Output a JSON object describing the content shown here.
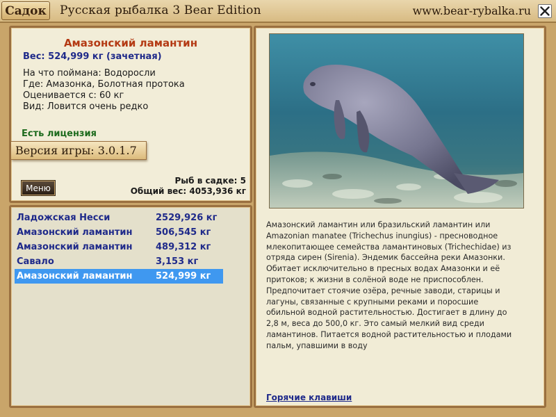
{
  "topbar": {
    "sadok_label": "Садок",
    "app_title": "Русская рыбалка 3 Bear Edition",
    "site_url": "www.bear-rybalka.ru"
  },
  "info": {
    "fish_name": "Амазонский ламантин",
    "weight_line": "Вес: 524,999 кг (зачетная)",
    "details": [
      "На что поймана: Водоросли",
      "Где: Амазонка, Болотная протока",
      "Оценивается с: 60 кг",
      "Вид: Ловится очень редко"
    ],
    "license": "Есть лицензия",
    "version": "Версия игры: 3.0.1.7",
    "menu_label": "Меню",
    "fish_count": "Рыб в садке: 5",
    "total_weight": "Общий вес: 4053,936 кг"
  },
  "catch_list": [
    {
      "name": "Ладожская Несси",
      "weight": "2529,926 кг",
      "selected": false
    },
    {
      "name": "Амазонский ламантин",
      "weight": "506,545 кг",
      "selected": false
    },
    {
      "name": "Амазонский ламантин",
      "weight": "489,312 кг",
      "selected": false
    },
    {
      "name": "Савало",
      "weight": "3,153 кг",
      "selected": false
    },
    {
      "name": "Амазонский ламантин",
      "weight": "524,999 кг",
      "selected": true
    }
  ],
  "description": "Амазонский ламантин или бразильский ламантин или Amazonian manatee (Trichechus inungius) - пресноводное млекопитающее семейства ламантиновых (Trichechidae) из отряда сирен (Sirenia). Эндемик бассейна реки Амазонки. Обитает исключительно в пресных водах Амазонки и её притоков; к жизни в солёной воде не приспособлен. Предпочитает стоячие озёра, речные заводи, старицы и лагуны, связанные с крупными реками и поросшие обильной водной растительностью. Достигает в длину до 2,8 м, веса до 500,0 кг. Это самый мелкий вид среди ламантинов. Питается водной растительностью и плодами пальм, упавшими в воду",
  "hotkeys_label": "Горячие клавиши",
  "colors": {
    "accent_name": "#b43a14",
    "link_blue": "#1f2a8a",
    "selection": "#3f98f0",
    "license_green": "#1e6b1e"
  },
  "icons": {
    "close": "close-icon"
  }
}
